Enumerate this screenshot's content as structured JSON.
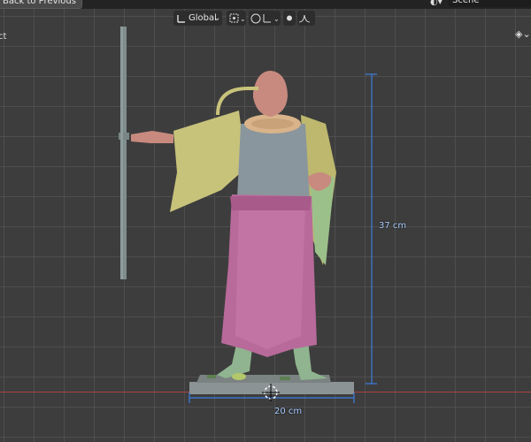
{
  "header": {
    "back_button": "Back to Previous",
    "scene_name": "Scene"
  },
  "toolbar": {
    "transform_orientation": "Global"
  },
  "viewport": {
    "left_label": "ct",
    "dimension_height": "37 cm",
    "dimension_width": "20 cm"
  },
  "colors": {
    "robe_pink": "#b86a9a",
    "cape_yellow": "#c8c37a",
    "shirt_gray": "#8a969d",
    "skin_flesh": "#c88a7e",
    "legs_green": "#8fb48f",
    "base_gray": "#8c9394",
    "measure_blue": "#3d7fe0",
    "x_axis_red": "#b04242"
  }
}
